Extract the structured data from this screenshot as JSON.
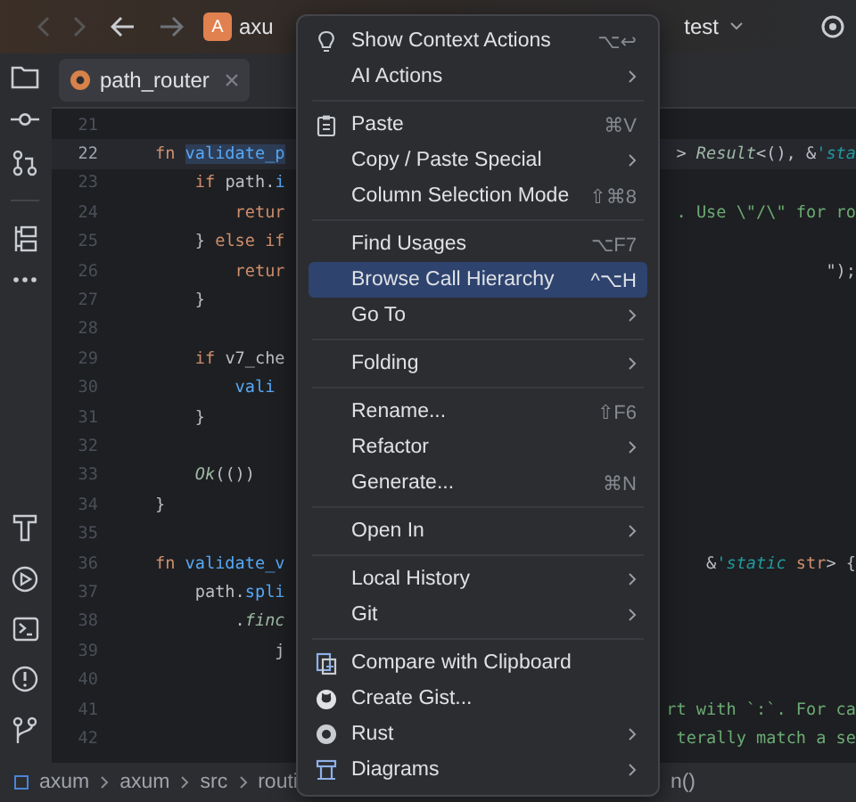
{
  "title_bar": {
    "project_badge": "A",
    "project_name": "axu",
    "run_config": "test"
  },
  "tab": {
    "label": "path_router"
  },
  "editor": {
    "lines": [
      {
        "number": "21",
        "current": false
      },
      {
        "number": "22",
        "current": true,
        "left": [
          {
            "t": "fn ",
            "kind": "kw"
          },
          {
            "t": "validate_p",
            "kind": "fn-highlight"
          }
        ],
        "right": [
          {
            "t": "> ",
            "kind": "plain"
          },
          {
            "t": "Result",
            "kind": "type"
          },
          {
            "t": "<(), &",
            "kind": "plain"
          },
          {
            "t": "'sta",
            "kind": "lifetime"
          }
        ]
      },
      {
        "number": "23",
        "current": false,
        "left": [
          {
            "t": "    if ",
            "kind": "kw"
          },
          {
            "t": "path.",
            "kind": "plain"
          },
          {
            "t": "i",
            "kind": "method"
          }
        ]
      },
      {
        "number": "24",
        "current": false,
        "left": [
          {
            "t": "        retur",
            "kind": "kw"
          }
        ],
        "right": [
          {
            "t": ". Use \\\"/\\\" for ro",
            "kind": "str"
          }
        ]
      },
      {
        "number": "25",
        "current": false,
        "left": [
          {
            "t": "    } ",
            "kind": "plain"
          },
          {
            "t": "else if",
            "kind": "kw"
          }
        ]
      },
      {
        "number": "26",
        "current": false,
        "left": [
          {
            "t": "        retur",
            "kind": "kw"
          }
        ],
        "right": [
          {
            "t": "\");",
            "kind": "plain"
          }
        ]
      },
      {
        "number": "27",
        "current": false,
        "left": [
          {
            "t": "    }",
            "kind": "plain"
          }
        ]
      },
      {
        "number": "28",
        "current": false
      },
      {
        "number": "29",
        "current": false,
        "left": [
          {
            "t": "    if ",
            "kind": "kw"
          },
          {
            "t": "v7_che",
            "kind": "plain"
          }
        ]
      },
      {
        "number": "30",
        "current": false,
        "left": [
          {
            "t": "        vali",
            "kind": "fn"
          }
        ]
      },
      {
        "number": "31",
        "current": false,
        "left": [
          {
            "t": "    }",
            "kind": "plain"
          }
        ]
      },
      {
        "number": "32",
        "current": false
      },
      {
        "number": "33",
        "current": false,
        "left": [
          {
            "t": "    Ok",
            "kind": "type"
          },
          {
            "t": "(())",
            "kind": "plain"
          }
        ]
      },
      {
        "number": "34",
        "current": false,
        "left": [
          {
            "t": "}",
            "kind": "plain"
          }
        ]
      },
      {
        "number": "35",
        "current": false
      },
      {
        "number": "36",
        "current": false,
        "left": [
          {
            "t": "fn ",
            "kind": "kw"
          },
          {
            "t": "validate_v",
            "kind": "fn"
          }
        ],
        "right": [
          {
            "t": "&",
            "kind": "plain"
          },
          {
            "t": "'static ",
            "kind": "lifetime"
          },
          {
            "t": "str",
            "kind": "kw"
          },
          {
            "t": "> {",
            "kind": "plain"
          }
        ]
      },
      {
        "number": "37",
        "current": false,
        "left": [
          {
            "t": "    path.",
            "kind": "plain"
          },
          {
            "t": "spli",
            "kind": "method"
          }
        ]
      },
      {
        "number": "38",
        "current": false,
        "left": [
          {
            "t": "        .",
            "kind": "plain"
          },
          {
            "t": "finc",
            "kind": "type"
          }
        ]
      },
      {
        "number": "39",
        "current": false,
        "left": [
          {
            "t": "            j",
            "kind": "plain"
          }
        ]
      },
      {
        "number": "40",
        "current": false
      },
      {
        "number": "41",
        "current": false,
        "right": [
          {
            "t": "rt with `:`. For ca",
            "kind": "str"
          }
        ]
      },
      {
        "number": "42",
        "current": false,
        "right": [
          {
            "t": "terally match a se",
            "kind": "str"
          }
        ]
      }
    ]
  },
  "breadcrumbs": {
    "items": [
      "axum",
      "axum",
      "src",
      "routi"
    ],
    "tail": "n()"
  },
  "context_menu": {
    "groups": [
      [
        {
          "label": "Show Context Actions",
          "shortcut": "⌥↩",
          "submenu": false,
          "selected": false
        },
        {
          "label": "AI Actions",
          "submenu": true,
          "selected": false
        }
      ],
      [
        {
          "label": "Paste",
          "shortcut": "⌘V",
          "submenu": false,
          "selected": false
        },
        {
          "label": "Copy / Paste Special",
          "submenu": true,
          "selected": false
        },
        {
          "label": "Column Selection Mode",
          "shortcut": "⇧⌘8",
          "submenu": false,
          "selected": false
        }
      ],
      [
        {
          "label": "Find Usages",
          "shortcut": "⌥F7",
          "submenu": false,
          "selected": false
        },
        {
          "label": "Browse Call Hierarchy",
          "shortcut": "^⌥H",
          "submenu": false,
          "selected": true
        },
        {
          "label": "Go To",
          "submenu": true,
          "selected": false
        }
      ],
      [
        {
          "label": "Folding",
          "submenu": true,
          "selected": false
        }
      ],
      [
        {
          "label": "Rename...",
          "shortcut": "⇧F6",
          "submenu": false,
          "selected": false
        },
        {
          "label": "Refactor",
          "submenu": true,
          "selected": false
        },
        {
          "label": "Generate...",
          "shortcut": "⌘N",
          "submenu": false,
          "selected": false
        }
      ],
      [
        {
          "label": "Open In",
          "submenu": true,
          "selected": false
        }
      ],
      [
        {
          "label": "Local History",
          "submenu": true,
          "selected": false
        },
        {
          "label": "Git",
          "submenu": true,
          "selected": false
        }
      ],
      [
        {
          "label": "Compare with Clipboard",
          "submenu": false,
          "selected": false
        },
        {
          "label": "Create Gist...",
          "submenu": false,
          "selected": false
        },
        {
          "label": "Rust",
          "submenu": true,
          "selected": false
        },
        {
          "label": "Diagrams",
          "submenu": true,
          "selected": false
        }
      ]
    ]
  }
}
